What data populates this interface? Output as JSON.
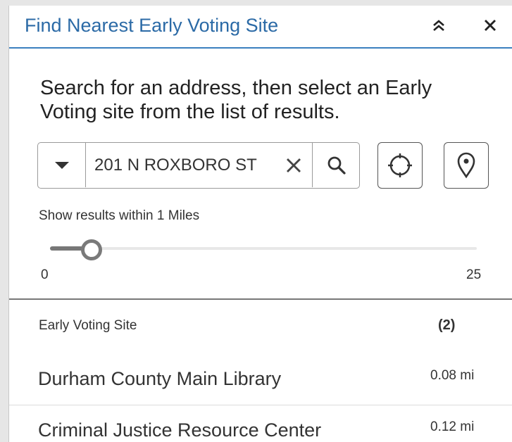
{
  "widget": {
    "title": "Find Nearest Early Voting Site"
  },
  "instructions": "Search for an address, then select an Early Voting site from the list of results.",
  "search": {
    "value": "201 N ROXBORO ST",
    "placeholder": ""
  },
  "slider": {
    "label": "Show results within 1 Miles",
    "min_label": "0",
    "max_label": "25",
    "min": 0,
    "max": 25,
    "value": 1
  },
  "results": {
    "header_label": "Early Voting Site",
    "count_label": "(2)",
    "items": [
      {
        "name": "Durham County Main Library",
        "distance": "0.08 mi"
      },
      {
        "name": "Criminal Justice Resource Center",
        "distance": "0.12 mi"
      }
    ]
  },
  "icons": {
    "collapse": "double-chevron-up-icon",
    "close": "close-icon",
    "dropdown": "caret-down-icon",
    "clear": "clear-x-icon",
    "search": "search-icon",
    "locate": "crosshair-icon",
    "pin": "map-pin-icon"
  },
  "colors": {
    "title": "#2b6aa6",
    "accent_border": "#3b7fbf",
    "background": "#e6e6e6"
  }
}
